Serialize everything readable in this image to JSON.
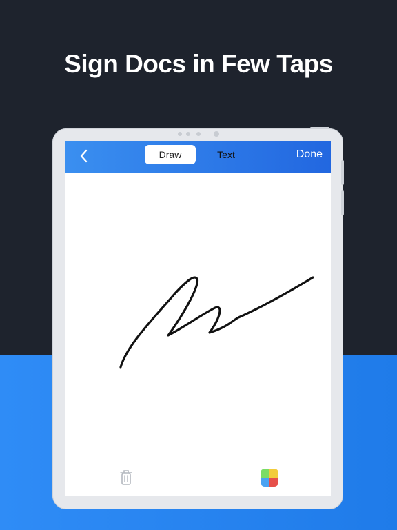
{
  "headline": "Sign Docs in Few Taps",
  "topbar": {
    "segments": [
      {
        "label": "Draw",
        "selected": true
      },
      {
        "label": "Text",
        "selected": false
      }
    ],
    "done_label": "Done"
  },
  "icons": {
    "back": "chevron-left-icon",
    "trash": "trash-icon",
    "palette": "color-palette-icon"
  },
  "colors": {
    "background_top": "#1e232d",
    "background_bottom": "#2a86f2",
    "topbar": "#2f7ae8",
    "signature_ink": "#111111",
    "palette": [
      "#7bdc66",
      "#f2cc3b",
      "#4aa3f2",
      "#e6504a"
    ]
  }
}
